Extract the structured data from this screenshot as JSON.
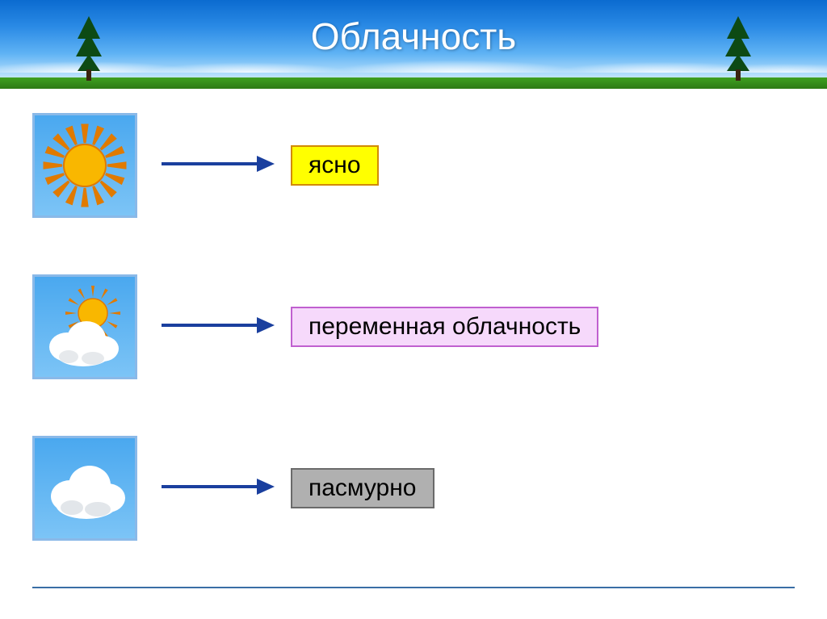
{
  "title": "Облачность",
  "rows": [
    {
      "label": "ясно",
      "class": "label-yellow"
    },
    {
      "label": "переменная облачность",
      "class": "label-pink"
    },
    {
      "label": "пасмурно",
      "class": "label-gray"
    }
  ],
  "colors": {
    "arrow": "#1a3f9e",
    "sun_fill": "#f9b700",
    "sun_ray": "#e07a00",
    "cloud": "#ffffff",
    "cloud_shadow": "#d8dde2"
  }
}
